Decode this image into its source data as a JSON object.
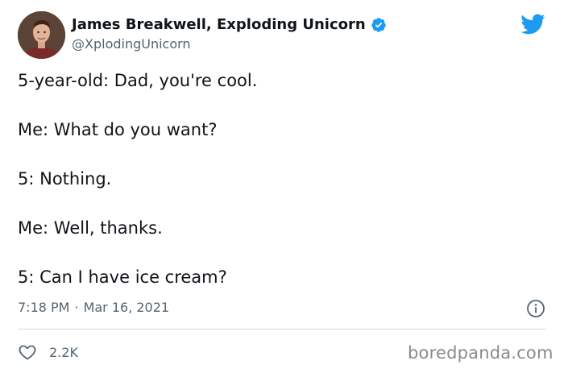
{
  "author": {
    "name": "James Breakwell, Exploding Unicorn",
    "handle": "@XplodingUnicorn",
    "verified_icon": "verified-badge-icon",
    "avatar_icon": "avatar-photo"
  },
  "brand_icon": "twitter-bird-icon",
  "tweet": {
    "lines": [
      "5-year-old: Dad, you're cool.",
      "Me: What do you want?",
      "5: Nothing.",
      "Me: Well, thanks.",
      "5: Can I have ice cream?"
    ],
    "time": "7:18 PM",
    "separator": "·",
    "date": "Mar 16, 2021",
    "likes": "2.2K"
  },
  "icons": {
    "info": "info-icon",
    "like": "heart-icon"
  },
  "watermark": "boredpanda.com",
  "colors": {
    "text": "#0f1419",
    "secondary": "#536471",
    "brand_blue": "#1d9bf0",
    "divider": "#cfd9de",
    "watermark": "#8a8a8a"
  }
}
